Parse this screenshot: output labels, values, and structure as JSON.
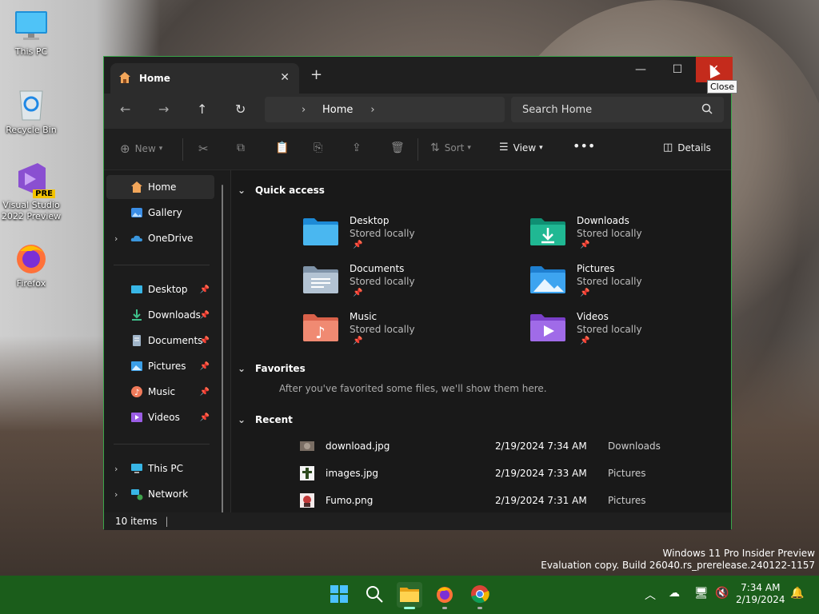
{
  "desktop": {
    "icons": [
      {
        "label": "This PC"
      },
      {
        "label": "Recycle Bin"
      },
      {
        "label": "Visual Studio 2022 Preview",
        "badge": "PRE"
      },
      {
        "label": "Firefox"
      }
    ]
  },
  "window": {
    "tab_title": "Home",
    "tooltip": "Close",
    "address": {
      "crumb": "Home"
    },
    "search_placeholder": "Search Home",
    "toolbar": {
      "new_label": "New",
      "sort_label": "Sort",
      "view_label": "View",
      "details_label": "Details"
    },
    "sidebar": {
      "top": [
        {
          "label": "Home",
          "icon": "home-icon"
        },
        {
          "label": "Gallery",
          "icon": "gallery-icon"
        },
        {
          "label": "OneDrive",
          "icon": "onedrive-icon"
        }
      ],
      "pinned": [
        {
          "label": "Desktop",
          "icon": "desktop-icon"
        },
        {
          "label": "Downloads",
          "icon": "downloads-icon"
        },
        {
          "label": "Documents",
          "icon": "documents-icon"
        },
        {
          "label": "Pictures",
          "icon": "pictures-icon"
        },
        {
          "label": "Music",
          "icon": "music-icon"
        },
        {
          "label": "Videos",
          "icon": "videos-icon"
        }
      ],
      "bottom": [
        {
          "label": "This PC",
          "icon": "this-pc-icon"
        },
        {
          "label": "Network",
          "icon": "network-icon"
        }
      ]
    },
    "sections": {
      "quick_access": "Quick access",
      "favorites": "Favorites",
      "favorites_empty": "After you've favorited some files, we'll show them here.",
      "recent": "Recent"
    },
    "quick_access_items": [
      {
        "name": "Desktop",
        "sub": "Stored locally"
      },
      {
        "name": "Downloads",
        "sub": "Stored locally"
      },
      {
        "name": "Documents",
        "sub": "Stored locally"
      },
      {
        "name": "Pictures",
        "sub": "Stored locally"
      },
      {
        "name": "Music",
        "sub": "Stored locally"
      },
      {
        "name": "Videos",
        "sub": "Stored locally"
      }
    ],
    "recent_items": [
      {
        "name": "download.jpg",
        "date": "2/19/2024 7:34 AM",
        "location": "Downloads"
      },
      {
        "name": "images.jpg",
        "date": "2/19/2024 7:33 AM",
        "location": "Pictures"
      },
      {
        "name": "Fumo.png",
        "date": "2/19/2024 7:31 AM",
        "location": "Pictures"
      }
    ],
    "status": "10 items"
  },
  "watermark": {
    "line1": "Windows 11 Pro Insider Preview",
    "line2": "Evaluation copy. Build 26040.rs_prerelease.240122-1157"
  },
  "taskbar": {
    "time": "7:34 AM",
    "date": "2/19/2024"
  },
  "colors": {
    "accent_border": "#3aa64a",
    "close_button": "#c42b1c",
    "taskbar": "#1b5d1b"
  }
}
